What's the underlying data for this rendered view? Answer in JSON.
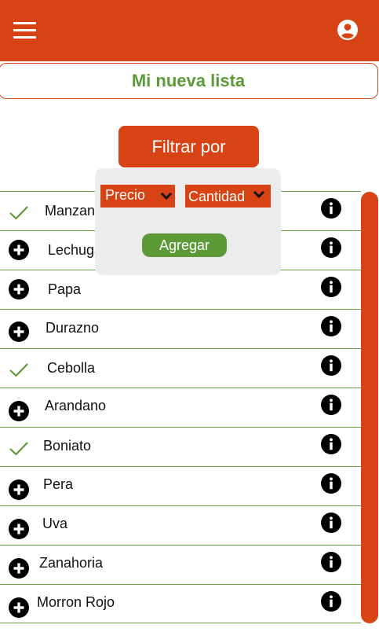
{
  "header": {
    "menu_icon": "hamburger-menu-icon",
    "account_icon": "account-circle-icon",
    "background_color": "#D84315"
  },
  "list_title": "Mi nueva lista",
  "filter_button_label": "Filtrar por",
  "filter_popup": {
    "select_price": "Precio",
    "select_quantity": "Cantidad",
    "add_button_label": "Agregar"
  },
  "items": [
    {
      "name": "Manzana",
      "status": "checked"
    },
    {
      "name": "Lechuga",
      "status": "add"
    },
    {
      "name": "Papa",
      "status": "add"
    },
    {
      "name": "Durazno",
      "status": "add"
    },
    {
      "name": "Cebolla",
      "status": "checked"
    },
    {
      "name": "Arandano",
      "status": "add"
    },
    {
      "name": "Boniato",
      "status": "checked"
    },
    {
      "name": "Pera",
      "status": "add"
    },
    {
      "name": "Uva",
      "status": "add"
    },
    {
      "name": "Zanahoria",
      "status": "add"
    },
    {
      "name": "Morron Rojo",
      "status": "add"
    }
  ],
  "colors": {
    "accent": "#D84315",
    "green": "#5B9A36",
    "divider": "#6AA345"
  }
}
